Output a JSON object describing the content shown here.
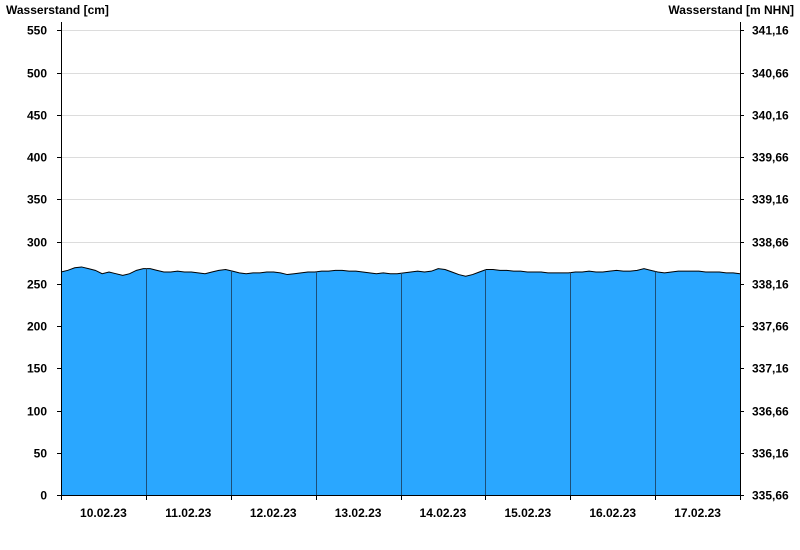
{
  "chart_data": {
    "type": "area",
    "ylabel_left": "Wasserstand [cm]",
    "ylabel_right": "Wasserstand [m NHN]",
    "ylim": [
      0,
      560
    ],
    "y_ticks": [
      0,
      50,
      100,
      150,
      200,
      250,
      300,
      350,
      400,
      450,
      500,
      550
    ],
    "right_ticks": [
      "335,66",
      "336,16",
      "336,66",
      "337,16",
      "337,66",
      "338,16",
      "338,66",
      "339,16",
      "339,66",
      "340,16",
      "340,66",
      "341,16"
    ],
    "x_labels": [
      "10.02.23",
      "11.02.23",
      "12.02.23",
      "13.02.23",
      "14.02.23",
      "15.02.23",
      "16.02.23",
      "17.02.23"
    ],
    "fill_color": "#2aa7ff",
    "line_color": "#000000",
    "grid": true,
    "series": [
      {
        "values": [
          264,
          266,
          269,
          270,
          268,
          266,
          262,
          264,
          262,
          260,
          262,
          266,
          268,
          268,
          266,
          264,
          264,
          265,
          264,
          264,
          263,
          262,
          264,
          266,
          267,
          265,
          263,
          262,
          263,
          263,
          264,
          264,
          263,
          261,
          262,
          263,
          264,
          264,
          265,
          265,
          266,
          266,
          265,
          265,
          264,
          263,
          262,
          263,
          262,
          262,
          263,
          264,
          265,
          264,
          265,
          268,
          267,
          264,
          261,
          259,
          261,
          264,
          267,
          267,
          266,
          266,
          265,
          265,
          264,
          264,
          264,
          263,
          263,
          263,
          263,
          264,
          264,
          265,
          264,
          264,
          265,
          266,
          265,
          265,
          266,
          268,
          266,
          264,
          263,
          264,
          265,
          265,
          265,
          265,
          264,
          264,
          264,
          263,
          263,
          262
        ]
      }
    ]
  }
}
